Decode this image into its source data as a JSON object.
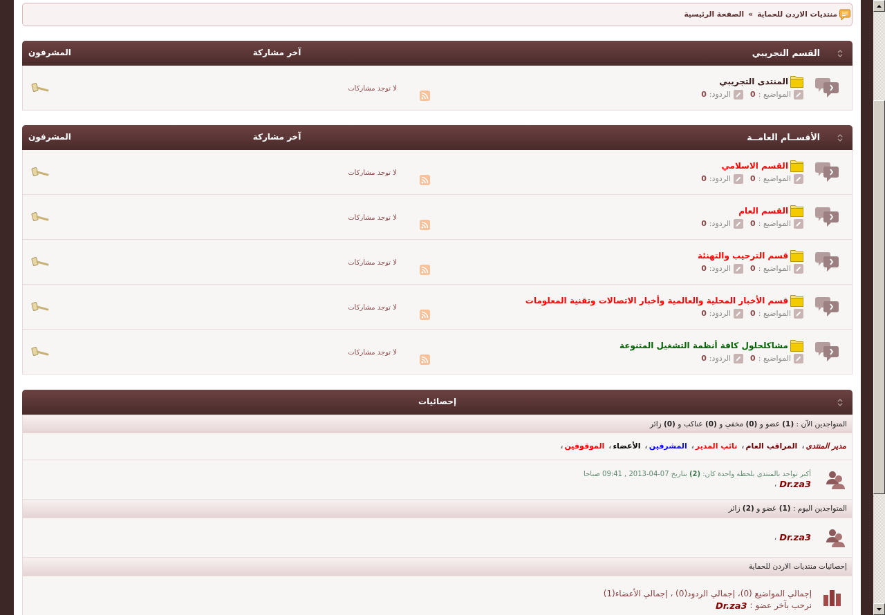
{
  "breadcrumb": {
    "links": [
      "منتديات الاردن للحماية",
      "الصفحة الرئيسية"
    ],
    "separator": "»"
  },
  "categories": [
    {
      "title": "القسم التجريبي",
      "columns": {
        "last_post": "آخر مشاركة",
        "moderators": "المشرفون"
      },
      "forums": [
        {
          "name": "المنتدى التجريبي",
          "color": "#3a1c1c",
          "topics_label": "المواضيع :",
          "topics": "0",
          "replies_label": "الردود:",
          "replies": "0",
          "last_post": "لا توجد مشاركات"
        }
      ]
    },
    {
      "title": "الأقســام العامــة",
      "columns": {
        "last_post": "آخر مشاركة",
        "moderators": "المشرفون"
      },
      "forums": [
        {
          "name": "القسم الاسلامي",
          "color": "#ff0000",
          "topics_label": "المواضيع :",
          "topics": "0",
          "replies_label": "الردود:",
          "replies": "0",
          "last_post": "لا توجد مشاركات"
        },
        {
          "name": "القسم العام",
          "color": "#ff0000",
          "topics_label": "المواضيع :",
          "topics": "0",
          "replies_label": "الردود:",
          "replies": "0",
          "last_post": "لا توجد مشاركات"
        },
        {
          "name": "قسم الترحيب والتهنئة",
          "color": "#ff0000",
          "topics_label": "المواضيع :",
          "topics": "0",
          "replies_label": "الردود:",
          "replies": "0",
          "last_post": "لا توجد مشاركات"
        },
        {
          "name": "قسم الأخبار المحلية والعالمية وأخبار الاتصالات وتقنية المعلومات",
          "color": "#ff0000",
          "topics_label": "المواضيع :",
          "topics": "0",
          "replies_label": "الردود:",
          "replies": "0",
          "last_post": "لا توجد مشاركات"
        },
        {
          "name": "مشاكلحلول كافة أنظمة التشغيل المتنوعة",
          "color": "#006400",
          "topics_label": "المواضيع :",
          "topics": "0",
          "replies_label": "الردود:",
          "replies": "0",
          "last_post": "لا توجد مشاركات"
        }
      ]
    }
  ],
  "stats": {
    "title": "إحصائيات",
    "online_now": {
      "heading": "المتواجدين الآن : **(1)** عضو و **(0)** مخفي و **(0)** عناكب و **(0)** زائر",
      "groups": [
        {
          "name": "مدير المنتدى",
          "color": "#800000",
          "italic": true,
          "separator": "،"
        },
        {
          "name": "المراقب العام",
          "color": "#6b0000",
          "italic": false,
          "separator": "،"
        },
        {
          "name": "نائب المدير",
          "color": "#ff0000",
          "italic": false,
          "separator": "،"
        },
        {
          "name": "المشرفين",
          "color": "#0000ff",
          "italic": false,
          "separator": "،"
        },
        {
          "name": "الأعضاء",
          "color": "#000000",
          "italic": false,
          "separator": "،"
        },
        {
          "name": "الموقوفين",
          "color": "#ff0000",
          "italic": false,
          "separator": "،"
        }
      ],
      "record": {
        "text": "أكبر تواجد بالمنتدى بلحظة واحدة كان: **(2)** بتاريخ 07-04-2013 , 09:41 صباحا",
        "members": [
          {
            "name": "Dr.za3",
            "separator": "،"
          }
        ]
      }
    },
    "online_today": {
      "heading": "المتواجدين اليوم : **(1)** عضو و **(2)** زائر",
      "members": [
        {
          "name": "Dr.za3",
          "separator": "،"
        }
      ]
    },
    "forum_stats": {
      "heading": "إحصائيات منتديات الاردن للحماية",
      "totals": "إجمالي المواضيع (0)، إجمالي الردود(0) ، إجمالي الأعضاء(1)",
      "welcome": "نرحب بآخر عضو :",
      "newest_member": "Dr.za3"
    }
  }
}
